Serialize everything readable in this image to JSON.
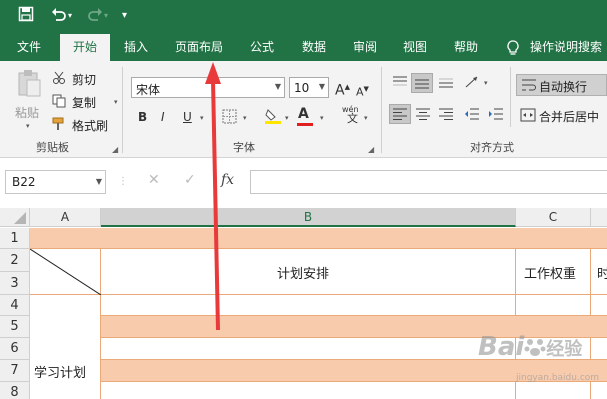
{
  "colors": {
    "brand": "#217346",
    "row_fill": "#f8cbad",
    "arrow": "#e83a3a"
  },
  "qat": {
    "save_icon": "save-icon",
    "undo_icon": "undo-icon",
    "redo_icon": "redo-icon",
    "customize_icon": "customize-qat-icon"
  },
  "tabs": [
    {
      "label": "文件"
    },
    {
      "label": "开始"
    },
    {
      "label": "插入"
    },
    {
      "label": "页面布局"
    },
    {
      "label": "公式"
    },
    {
      "label": "数据"
    },
    {
      "label": "审阅"
    },
    {
      "label": "视图"
    },
    {
      "label": "帮助"
    },
    {
      "label": "操作说明搜索"
    }
  ],
  "active_tab": "开始",
  "clipboard": {
    "paste": "粘贴",
    "cut": "剪切",
    "copy": "复制",
    "format_painter": "格式刷",
    "group_label": "剪贴板"
  },
  "font": {
    "name": "宋体",
    "size": "10",
    "bold": "B",
    "italic": "I",
    "underline": "U",
    "color_letter": "A",
    "wen_label": "wén",
    "wen_char": "文",
    "group_label": "字体"
  },
  "alignment": {
    "wrap_text": "自动换行",
    "merge_center": "合并后居中",
    "group_label": "对齐方式"
  },
  "formula_bar": {
    "name_box": "B22",
    "fx": "fx",
    "value": ""
  },
  "columns": [
    {
      "label": "A"
    },
    {
      "label": "B"
    },
    {
      "label": "C"
    }
  ],
  "rows": [
    {
      "label": "1"
    },
    {
      "label": "2"
    },
    {
      "label": "3"
    },
    {
      "label": "4"
    },
    {
      "label": "5"
    },
    {
      "label": "6"
    },
    {
      "label": "7"
    },
    {
      "label": "8"
    }
  ],
  "cells": {
    "plan": "计划安排",
    "weight": "工作权重",
    "time_partial": "时",
    "study_plan": "学习计划"
  },
  "watermark": {
    "brand": "Bai",
    "brand_tail": "经验",
    "url": "jingyan.baidu.com"
  }
}
